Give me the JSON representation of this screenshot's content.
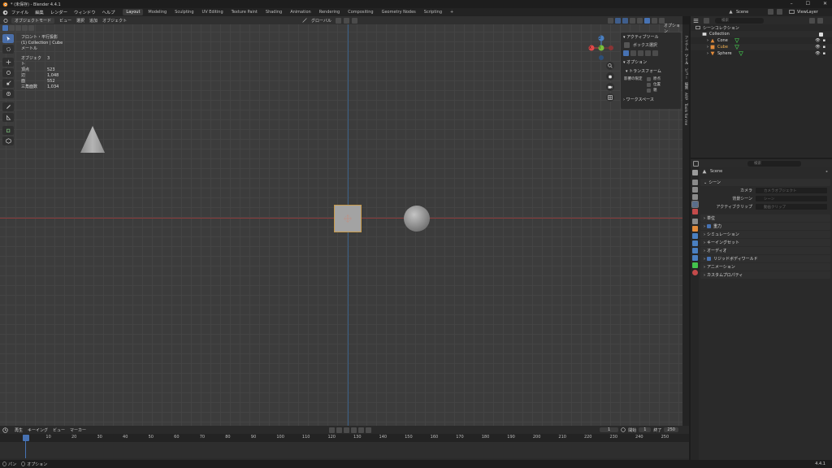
{
  "window": {
    "title": "* (未保存) - Blender 4.4.1",
    "controls": [
      "–",
      "☐",
      "✕"
    ]
  },
  "menu": {
    "items": [
      "ファイル",
      "編集",
      "レンダー",
      "ウィンドウ",
      "ヘルプ"
    ],
    "workspaces": [
      "Layout",
      "Modeling",
      "Sculpting",
      "UV Editing",
      "Texture Paint",
      "Shading",
      "Animation",
      "Rendering",
      "Compositing",
      "Geometry Nodes",
      "Scripting"
    ],
    "add_tab": "+",
    "scene": "Scene",
    "view_layer": "ViewLayer"
  },
  "viewport": {
    "mode": "オブジェクトモード",
    "header_menus": [
      "ビュー",
      "選択",
      "追加",
      "オブジェクト"
    ],
    "transform_orientation": "グローバル",
    "options_label": "オプション",
    "info": {
      "view": "フロント・平行投影",
      "collection": "(1) Collection | Cube",
      "unit": "メートル",
      "stats": [
        {
          "label": "オブジェクト",
          "value": "3"
        },
        {
          "label": "頂点",
          "value": "523"
        },
        {
          "label": "辺",
          "value": "1,048"
        },
        {
          "label": "面",
          "value": "552"
        },
        {
          "label": "三角面数",
          "value": "1,034"
        }
      ]
    },
    "npanel": {
      "active_tool": "アクティブツール",
      "box_select": "ボックス選択",
      "options": "オプション",
      "transform": "トランスフォーム",
      "affect_only": "影響の限定",
      "origins": "原点",
      "locations": "位置",
      "parents": "親",
      "workspace": "ワークスペース"
    },
    "sidebar_tabs": [
      "アイテム",
      "ツール",
      "ビュー",
      "編集",
      "ARP",
      "Tools for me"
    ],
    "gizmo": {
      "x": "X",
      "y": "Y",
      "z": "Z"
    }
  },
  "timeline": {
    "menus": [
      "再生",
      "キーイング",
      "ビュー",
      "マーカー"
    ],
    "current_frame": "1",
    "start_label": "開始",
    "start": "1",
    "end_label": "終了",
    "end": "250",
    "ticks": [
      "1",
      "10",
      "20",
      "30",
      "40",
      "50",
      "60",
      "70",
      "80",
      "90",
      "100",
      "110",
      "120",
      "130",
      "140",
      "150",
      "160",
      "170",
      "180",
      "190",
      "200",
      "210",
      "220",
      "230",
      "240",
      "250"
    ]
  },
  "status": {
    "items": [
      "パン",
      "オプション"
    ],
    "version": "4.4.1"
  },
  "outliner": {
    "search_placeholder": "検索",
    "root": "シーンコレクション",
    "collection": "Collection",
    "objects": [
      "Cone",
      "Cube",
      "Sphere"
    ]
  },
  "properties": {
    "search_placeholder": "検索",
    "scene_name": "Scene",
    "section_scene": "シーン",
    "camera_label": "カメラ",
    "camera_placeholder": "カメラオブジェクト",
    "bg_scene_label": "背景シーン",
    "bg_scene_placeholder": "シーン",
    "active_clip_label": "アクティブクリップ",
    "active_clip_placeholder": "動画クリップ",
    "sections": [
      "単位",
      "重力",
      "シミュレーション",
      "キーイングセット",
      "オーディオ",
      "リジッドボディワールド",
      "アニメーション",
      "カスタムプロパティ"
    ]
  }
}
